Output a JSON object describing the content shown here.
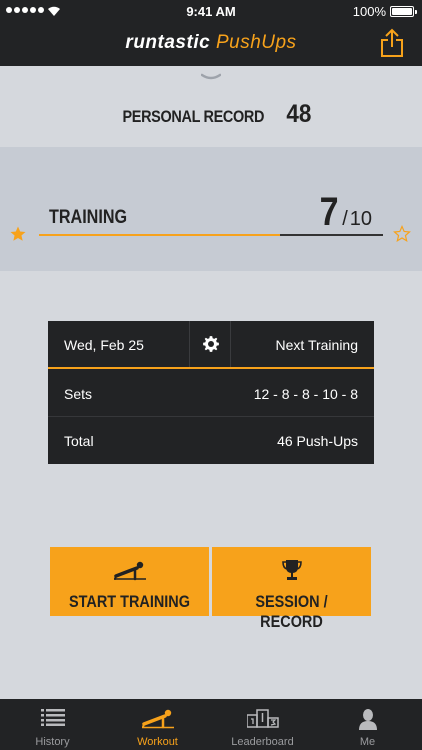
{
  "status_bar": {
    "time": "9:41 AM",
    "battery": "100%"
  },
  "header": {
    "brand_part1": "runtastic",
    "brand_part2": "PushUps"
  },
  "record": {
    "label": "PERSONAL RECORD",
    "value": "48"
  },
  "training": {
    "label": "TRAINING",
    "current": "7",
    "separator": "/",
    "total": "10",
    "progress": 0.7
  },
  "card": {
    "date": "Wed, Feb 25",
    "next_label": "Next Training",
    "sets_label": "Sets",
    "sets_value": "12 - 8 - 8 - 10 - 8",
    "total_label": "Total",
    "total_value": "46 Push-Ups"
  },
  "buttons": {
    "start_label": "START TRAINING",
    "session_label": "SESSION / RECORD"
  },
  "tabs": [
    {
      "label": "History",
      "icon": "list-icon"
    },
    {
      "label": "Workout",
      "icon": "pushup-icon",
      "active": true
    },
    {
      "label": "Leaderboard",
      "icon": "podium-icon"
    },
    {
      "label": "Me",
      "icon": "person-icon"
    }
  ],
  "colors": {
    "accent": "#f7a21b",
    "dark": "#222325",
    "background": "#d5d8dd",
    "band": "#c6cbd3"
  }
}
